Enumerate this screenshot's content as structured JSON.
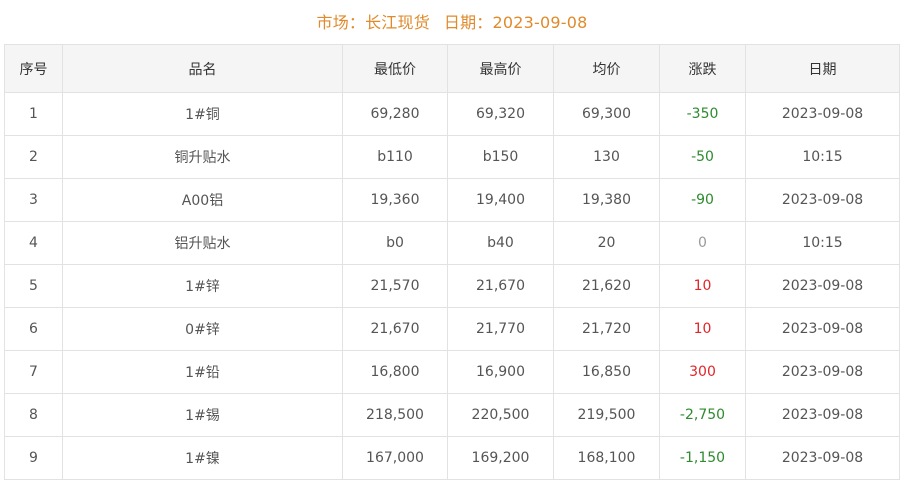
{
  "header": {
    "market_label": "市场：长江现货",
    "date_label": "日期：2023-09-08"
  },
  "table": {
    "columns": [
      "序号",
      "品名",
      "最低价",
      "最高价",
      "均价",
      "涨跌",
      "日期"
    ],
    "rows": [
      {
        "no": "1",
        "name": "1#铜",
        "low": "69,280",
        "high": "69,320",
        "avg": "69,300",
        "change": "-350",
        "dir": "neg",
        "date": "2023-09-08"
      },
      {
        "no": "2",
        "name": "铜升贴水",
        "low": "b110",
        "high": "b150",
        "avg": "130",
        "change": "-50",
        "dir": "neg",
        "date": "10:15"
      },
      {
        "no": "3",
        "name": "A00铝",
        "low": "19,360",
        "high": "19,400",
        "avg": "19,380",
        "change": "-90",
        "dir": "neg",
        "date": "2023-09-08"
      },
      {
        "no": "4",
        "name": "铝升贴水",
        "low": "b0",
        "high": "b40",
        "avg": "20",
        "change": "0",
        "dir": "zero",
        "date": "10:15"
      },
      {
        "no": "5",
        "name": "1#锌",
        "low": "21,570",
        "high": "21,670",
        "avg": "21,620",
        "change": "10",
        "dir": "pos",
        "date": "2023-09-08"
      },
      {
        "no": "6",
        "name": "0#锌",
        "low": "21,670",
        "high": "21,770",
        "avg": "21,720",
        "change": "10",
        "dir": "pos",
        "date": "2023-09-08"
      },
      {
        "no": "7",
        "name": "1#铅",
        "low": "16,800",
        "high": "16,900",
        "avg": "16,850",
        "change": "300",
        "dir": "pos",
        "date": "2023-09-08"
      },
      {
        "no": "8",
        "name": "1#锡",
        "low": "218,500",
        "high": "220,500",
        "avg": "219,500",
        "change": "-2,750",
        "dir": "neg",
        "date": "2023-09-08"
      },
      {
        "no": "9",
        "name": "1#镍",
        "low": "167,000",
        "high": "169,200",
        "avg": "168,100",
        "change": "-1,150",
        "dir": "neg",
        "date": "2023-09-08"
      }
    ]
  },
  "colors": {
    "title": "#e08a2b",
    "up": "#e0262b",
    "down": "#2e8b2e",
    "flat": "#9a9a9a",
    "header_bg": "#f5f5f5",
    "border": "#e2e2e2"
  }
}
